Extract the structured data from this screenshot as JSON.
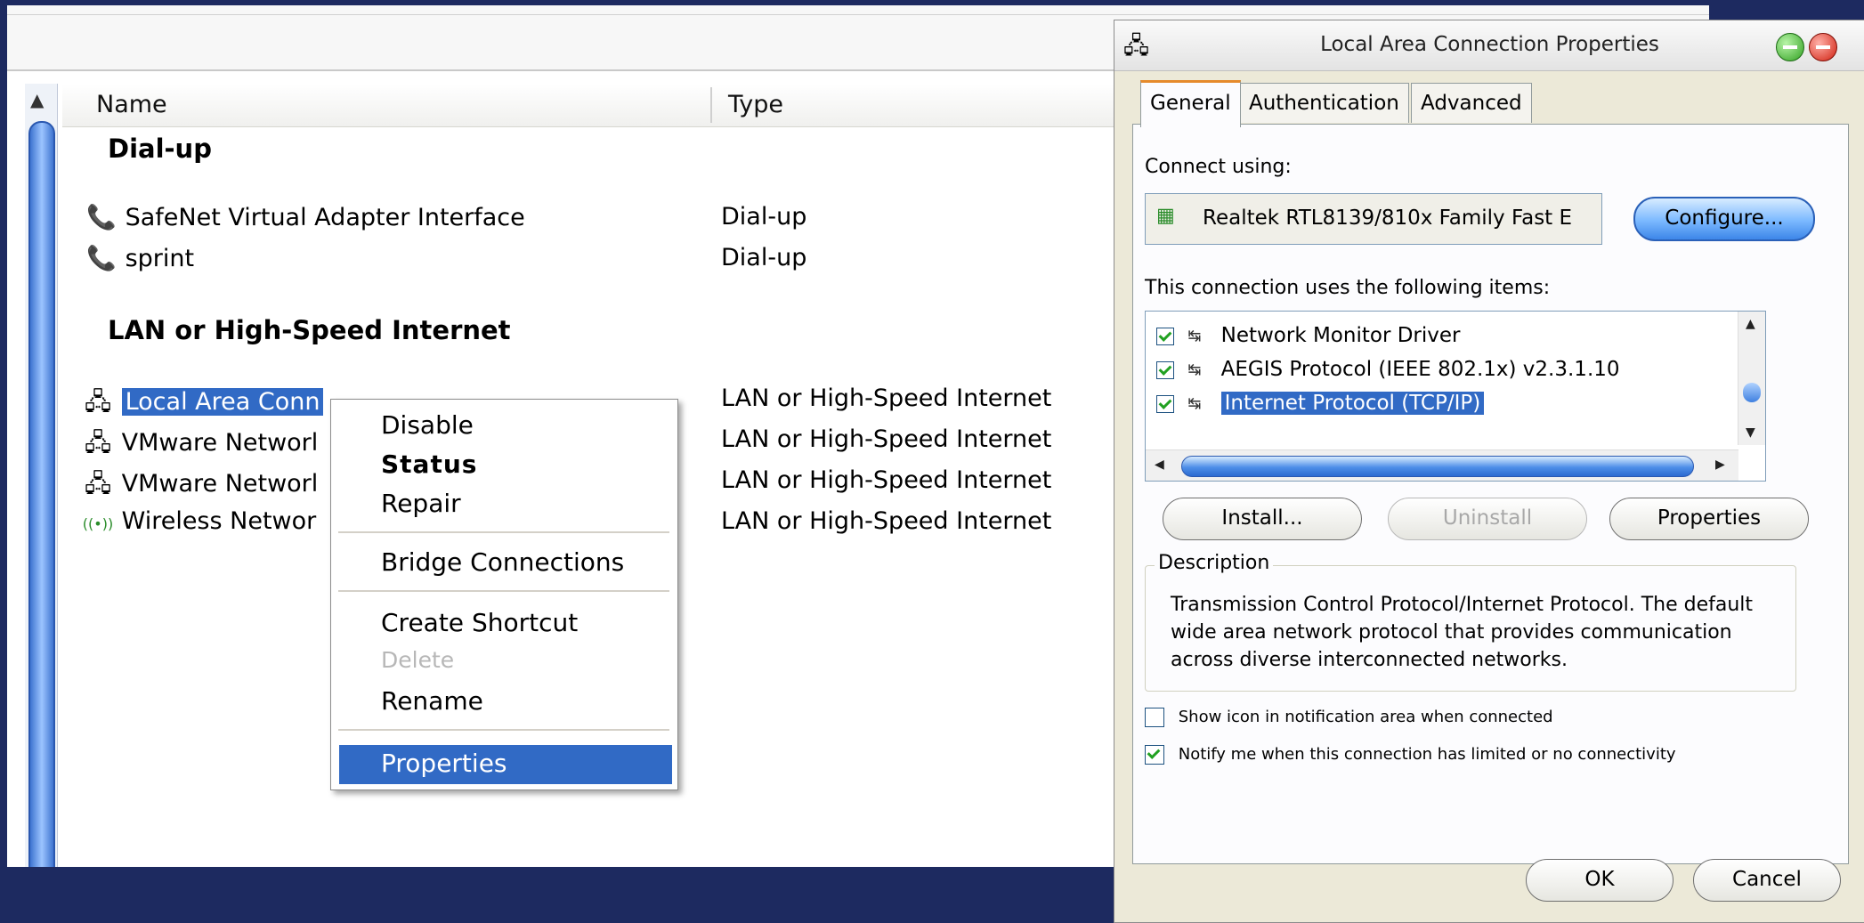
{
  "explorer": {
    "columns": {
      "name": "Name",
      "type": "Type"
    },
    "groups": {
      "dialup": {
        "title": "Dial-up",
        "rows": [
          {
            "name": "SafeNet Virtual Adapter Interface",
            "type": "Dial-up",
            "icon": "dialup-icon"
          },
          {
            "name": "sprint",
            "type": "Dial-up",
            "icon": "dialup-icon"
          }
        ]
      },
      "lan": {
        "title": "LAN or High-Speed Internet",
        "rows": [
          {
            "name": "Local Area Conn",
            "type": "LAN or High-Speed Internet",
            "icon": "lan-icon"
          },
          {
            "name": "VMware Networl",
            "type": "LAN or High-Speed Internet",
            "icon": "lan-icon"
          },
          {
            "name": "VMware Networl",
            "type": "LAN or High-Speed Internet",
            "icon": "lan-icon"
          },
          {
            "name": "Wireless Networ",
            "type": "LAN or High-Speed Internet",
            "icon": "wireless-icon"
          }
        ]
      }
    }
  },
  "context_menu": {
    "items": [
      {
        "label": "Disable",
        "state": "normal"
      },
      {
        "label": "Status",
        "state": "bold"
      },
      {
        "label": "Repair",
        "state": "normal"
      },
      {
        "label": "Bridge Connections",
        "state": "normal"
      },
      {
        "label": "Create Shortcut",
        "state": "normal"
      },
      {
        "label": "Delete",
        "state": "disabled"
      },
      {
        "label": "Rename",
        "state": "normal"
      },
      {
        "label": "Properties",
        "state": "highlighted"
      }
    ]
  },
  "dialog": {
    "title": "Local Area Connection Properties",
    "tabs": [
      "General",
      "Authentication",
      "Advanced"
    ],
    "active_tab": "General",
    "connect_using_label": "Connect using:",
    "adapter_name": "Realtek RTL8139/810x Family Fast E",
    "configure_button": "Configure...",
    "items_label": "This connection uses the following items:",
    "items": [
      {
        "label": "Network Monitor Driver",
        "checked": true
      },
      {
        "label": "AEGIS Protocol (IEEE 802.1x) v2.3.1.10",
        "checked": true
      },
      {
        "label": "Internet Protocol (TCP/IP)",
        "checked": true,
        "selected": true
      }
    ],
    "buttons": {
      "install": "Install...",
      "uninstall": "Uninstall",
      "properties": "Properties"
    },
    "description": {
      "legend": "Description",
      "text": "Transmission Control Protocol/Internet Protocol. The default wide area network protocol that provides communication across diverse interconnected networks."
    },
    "options": [
      {
        "label": "Show icon in notification area when connected",
        "checked": false
      },
      {
        "label": "Notify me when this connection has limited or no connectivity",
        "checked": true
      }
    ],
    "ok": "OK",
    "cancel": "Cancel"
  },
  "colors": {
    "background": "#1d2a60",
    "selection": "#316ac5",
    "active_tab_accent": "#e68b2c"
  }
}
